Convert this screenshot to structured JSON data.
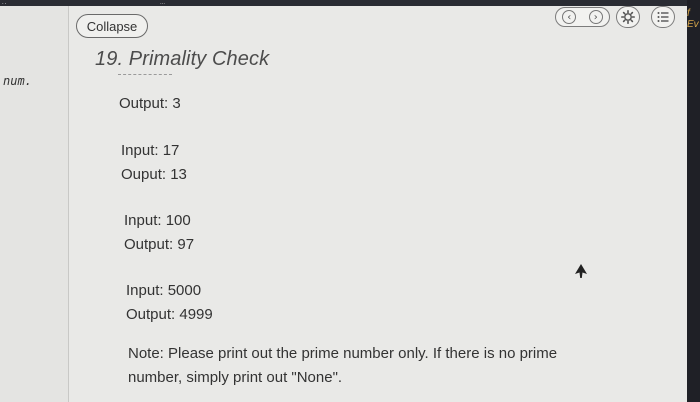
{
  "top_bar": {
    "left_fragment": "..",
    "tab_fragment": "...",
    "right_fragment": "f Ev"
  },
  "left_pane": {
    "fragment": "num."
  },
  "toolbar": {
    "collapse_label": "Collapse",
    "prev_glyph": "‹",
    "next_glyph": "›",
    "icons": [
      "chevron-left-icon",
      "chevron-right-icon",
      "gear-icon",
      "list-icon"
    ]
  },
  "problem": {
    "title": "19. Primality Check",
    "examples": [
      {
        "input": "",
        "output": "Output: 3"
      },
      {
        "input": "Input: 17",
        "output": "Ouput: 13"
      },
      {
        "input": "Input: 100",
        "output": "Output: 97"
      },
      {
        "input": "Input: 5000",
        "output": "Output: 4999"
      }
    ],
    "note_line1": "Note: Please print out the prime number only. If there is no prime",
    "note_line2": "number, simply print out \"None\"."
  }
}
